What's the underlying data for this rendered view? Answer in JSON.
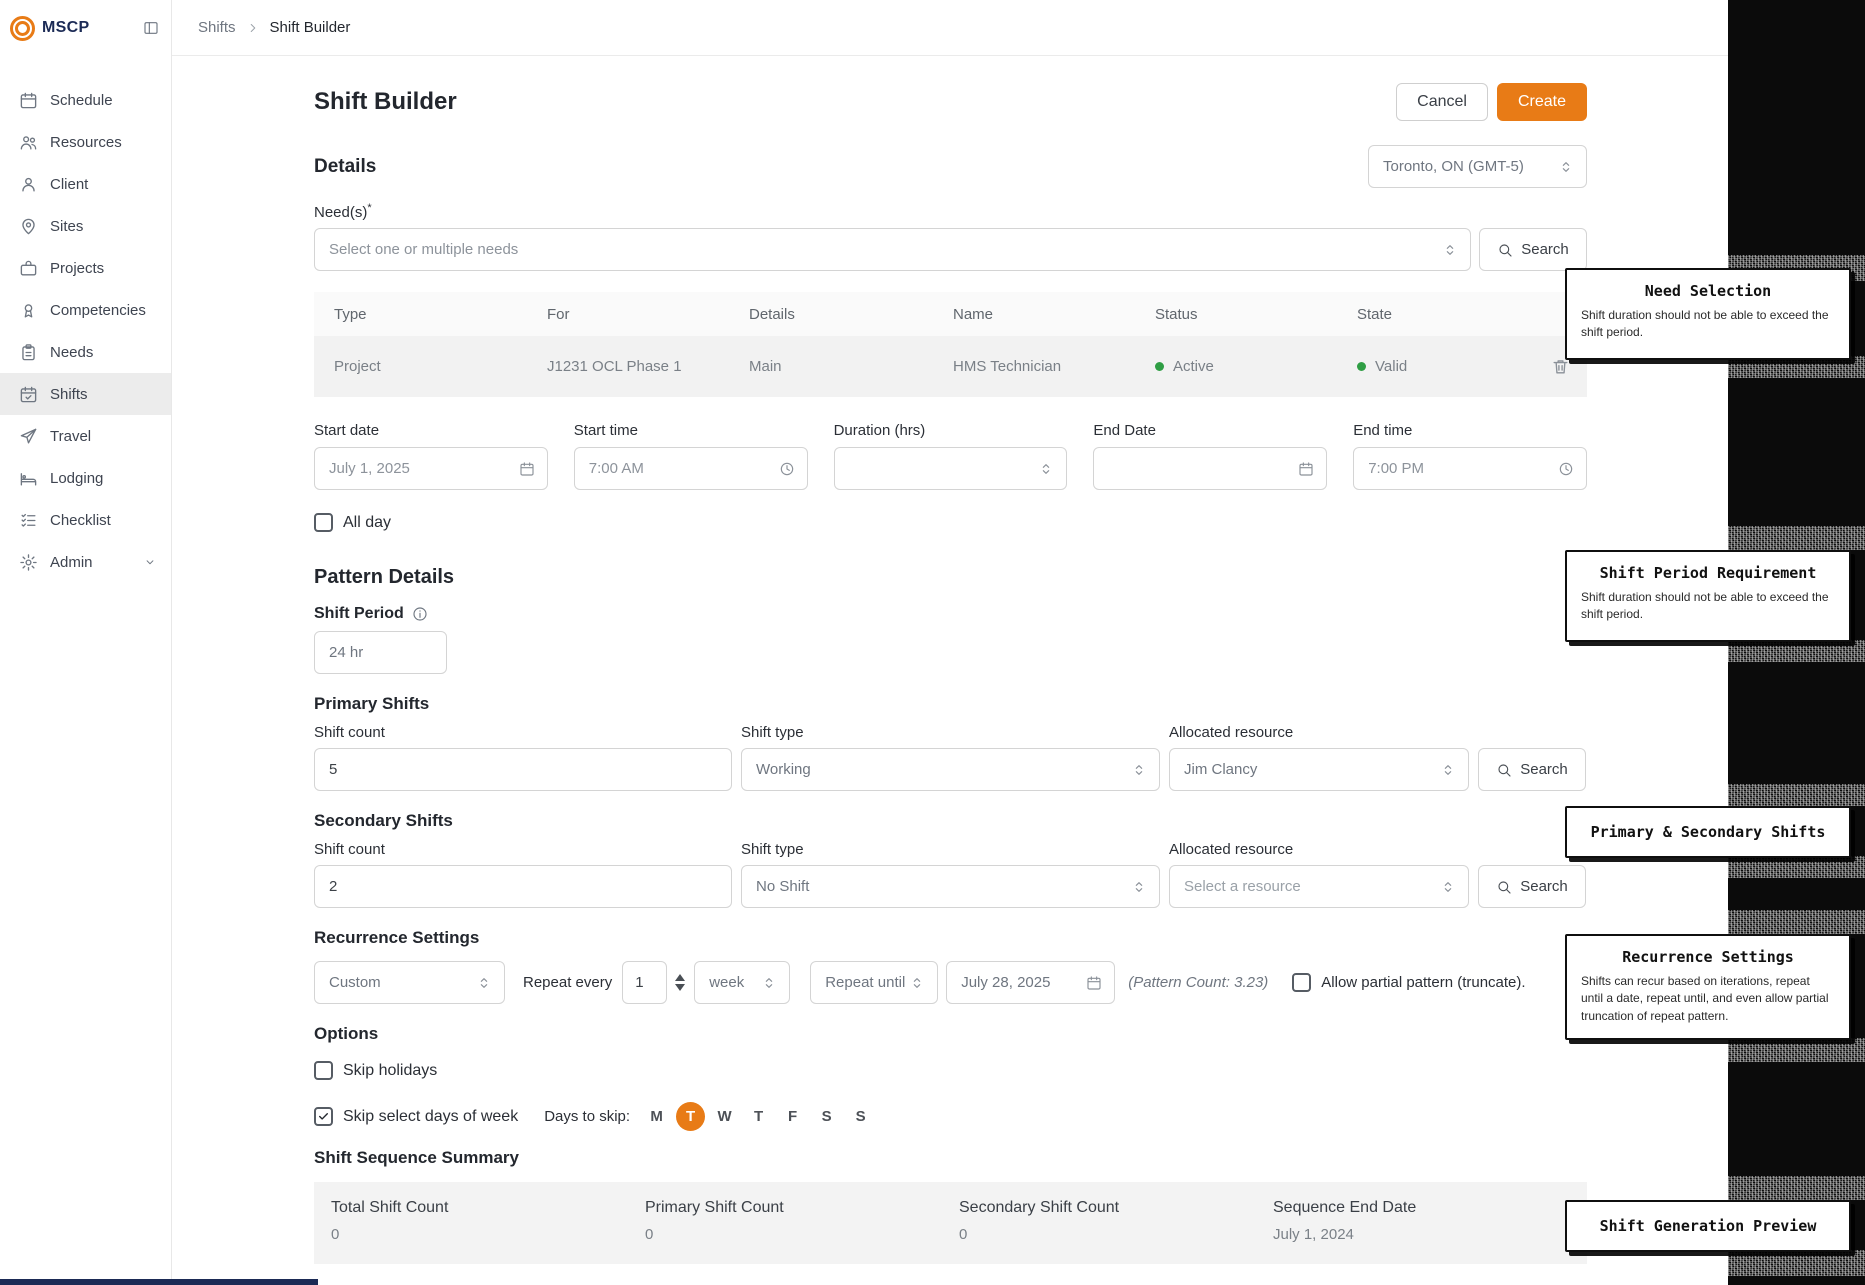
{
  "brand": {
    "name": "MSCP"
  },
  "breadcrumb": {
    "parent": "Shifts",
    "current": "Shift Builder"
  },
  "sidebar": {
    "items": [
      {
        "label": "Schedule"
      },
      {
        "label": "Resources"
      },
      {
        "label": "Client"
      },
      {
        "label": "Sites"
      },
      {
        "label": "Projects"
      },
      {
        "label": "Competencies"
      },
      {
        "label": "Needs"
      },
      {
        "label": "Shifts"
      },
      {
        "label": "Travel"
      },
      {
        "label": "Lodging"
      },
      {
        "label": "Checklist"
      },
      {
        "label": "Admin"
      }
    ],
    "active_item": "Shifts"
  },
  "header": {
    "title": "Shift Builder",
    "cancel_label": "Cancel",
    "create_label": "Create"
  },
  "ui": {
    "search_label": "Search"
  },
  "details": {
    "heading": "Details",
    "timezone_value": "Toronto, ON (GMT-5)",
    "needs_label": "Need(s)",
    "needs_required_mark": "*",
    "needs_placeholder": "Select one or multiple needs",
    "table": {
      "headers": [
        "Type",
        "For",
        "Details",
        "Name",
        "Status",
        "State"
      ],
      "row": {
        "type": "Project",
        "for": "J1231 OCL Phase 1",
        "details": "Main",
        "name": "HMS Technician",
        "status": "Active",
        "state": "Valid"
      }
    },
    "fields": {
      "start_date": {
        "label": "Start date",
        "value": "July 1, 2025"
      },
      "start_time": {
        "label": "Start time",
        "value": "7:00 AM"
      },
      "duration": {
        "label": "Duration (hrs)",
        "value": ""
      },
      "end_date": {
        "label": "End Date",
        "value": ""
      },
      "end_time": {
        "label": "End time",
        "value": "7:00 PM"
      }
    },
    "all_day_label": "All day"
  },
  "pattern": {
    "heading": "Pattern Details",
    "shift_period_label": "Shift Period",
    "shift_period_value": "24 hr",
    "primary": {
      "heading": "Primary Shifts",
      "count_label": "Shift count",
      "count_value": "5",
      "type_label": "Shift type",
      "type_value": "Working",
      "resource_label": "Allocated resource",
      "resource_value": "Jim Clancy"
    },
    "secondary": {
      "heading": "Secondary Shifts",
      "count_label": "Shift count",
      "count_value": "2",
      "type_label": "Shift type",
      "type_value": "No Shift",
      "resource_label": "Allocated resource",
      "resource_value": "Select a resource"
    }
  },
  "recurrence": {
    "heading": "Recurrence Settings",
    "mode_value": "Custom",
    "repeat_every_label": "Repeat every",
    "interval_value": "1",
    "unit_value": "week",
    "until_placeholder": "Repeat until",
    "until_date_value": "July 28, 2025",
    "pattern_count_text": "(Pattern Count: 3.23)",
    "allow_partial_label": "Allow partial pattern (truncate)."
  },
  "options": {
    "heading": "Options",
    "skip_holidays_label": "Skip holidays",
    "skip_days_label": "Skip select days of week",
    "days_to_skip_label": "Days to skip:",
    "days": [
      "M",
      "T",
      "W",
      "T",
      "F",
      "S",
      "S"
    ],
    "selected_index": 1
  },
  "summary": {
    "heading": "Shift Sequence Summary",
    "columns": [
      {
        "label": "Total Shift Count",
        "value": "0"
      },
      {
        "label": "Primary Shift Count",
        "value": "0"
      },
      {
        "label": "Secondary Shift Count",
        "value": "0"
      },
      {
        "label": "Sequence End Date",
        "value": "July 1, 2024"
      }
    ]
  },
  "callouts": [
    {
      "title": "Need Selection",
      "body": "Shift duration should not be able to exceed the shift period."
    },
    {
      "title": "Shift Period Requirement",
      "body": "Shift duration should not be able to exceed the shift period."
    },
    {
      "title": "Primary & Secondary Shifts",
      "body": ""
    },
    {
      "title": "Recurrence Settings",
      "body": "Shifts can recur based on iterations, repeat until a date, repeat until, and even allow partial truncation of repeat pattern."
    },
    {
      "title": "Shift Generation Preview",
      "body": ""
    }
  ],
  "colors": {
    "accent_orange": "#E87B16",
    "brand_navy": "#1B2A55",
    "status_green": "#2F9E44"
  }
}
